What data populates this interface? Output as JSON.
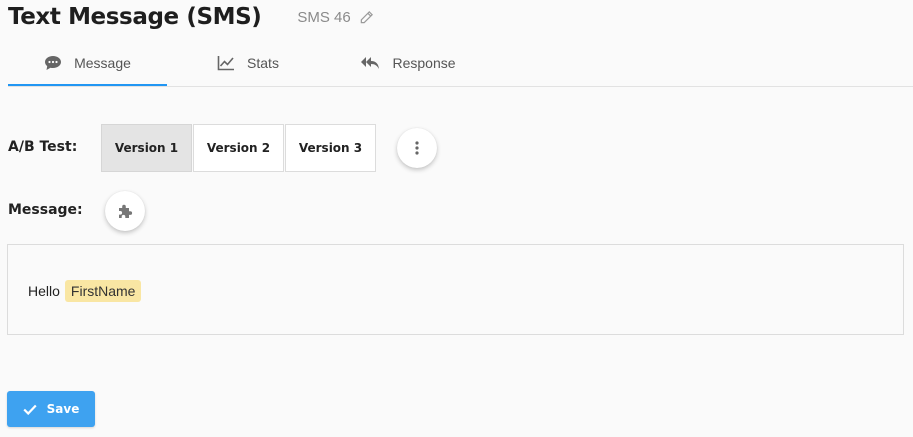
{
  "header": {
    "title": "Text Message (SMS)",
    "subtitle": "SMS 46",
    "edit_icon": "pencil-icon"
  },
  "tabs": [
    {
      "label": "Message",
      "icon": "speech-bubble-icon",
      "active": true
    },
    {
      "label": "Stats",
      "icon": "line-chart-icon",
      "active": false
    },
    {
      "label": "Response",
      "icon": "reply-all-icon",
      "active": false
    }
  ],
  "ab_test": {
    "label": "A/B Test:",
    "versions": [
      "Version 1",
      "Version 2",
      "Version 3"
    ],
    "selected": "Version 1",
    "more_icon": "vertical-dots-icon"
  },
  "message": {
    "label": "Message:",
    "insert_icon": "puzzle-piece-icon",
    "text": "Hello",
    "token": "FirstName"
  },
  "actions": {
    "save_label": "Save",
    "save_icon": "checkmark-icon"
  },
  "colors": {
    "accent": "#2196f3",
    "save_button": "#3ea2f0",
    "token_highlight": "#f9e6a3",
    "selected_version": "#e4e4e4"
  }
}
